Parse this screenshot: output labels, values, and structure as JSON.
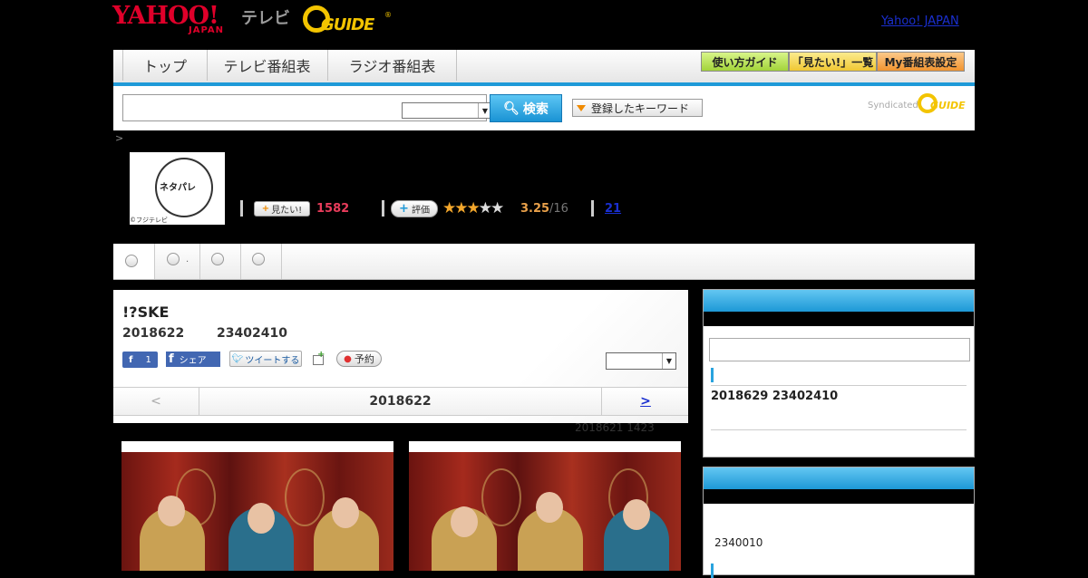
{
  "header": {
    "yahoo_logo": "YAHOO!",
    "yahoo_logo_sub": "JAPAN",
    "tv_label": "テレビ",
    "gguide_logo": "GUIDE",
    "yahoo_japan_link": "Yahoo! JAPAN"
  },
  "nav": {
    "tabs": [
      "トップ",
      "テレビ番組表",
      "ラジオ番組表"
    ],
    "buttons": [
      {
        "label": "使い方ガイド",
        "color": "#b6e04a"
      },
      {
        "label": "「見たい!」一覧",
        "color": "#f5d64a"
      },
      {
        "label": "My番組表設定",
        "color": "#f6a640"
      }
    ],
    "accent": "#1f9ad8"
  },
  "search": {
    "button_label": "検索",
    "keyword_button": "登録したキーワード",
    "syndicated": "Syndicated",
    "syndicated_logo": "GUIDE"
  },
  "breadcrumb": ">",
  "program": {
    "thumb_art": "ネタパレ",
    "copyright": "©フジテレビ",
    "mitai_label": "見たい!",
    "mitai_count": "1582",
    "hyoka_label": "評価",
    "stars_full": "★★★",
    "stars_empty": "★★",
    "score": "3.25",
    "score_count": "/16",
    "review_count": "21"
  },
  "tabs": {
    "second_dot": "."
  },
  "detail": {
    "title": "!?SKE",
    "date": "2018622",
    "time": "23402410",
    "fb_like_count": "1",
    "fb_share": "シェア",
    "tweet": "ツイートする",
    "yoyaku": "予約",
    "prev": "<",
    "current_date": "2018622",
    "next": ">",
    "updated": "2018621  1423"
  },
  "sidebar": {
    "next_broadcast": "2018629  23402410",
    "box2_text": "2340010"
  }
}
